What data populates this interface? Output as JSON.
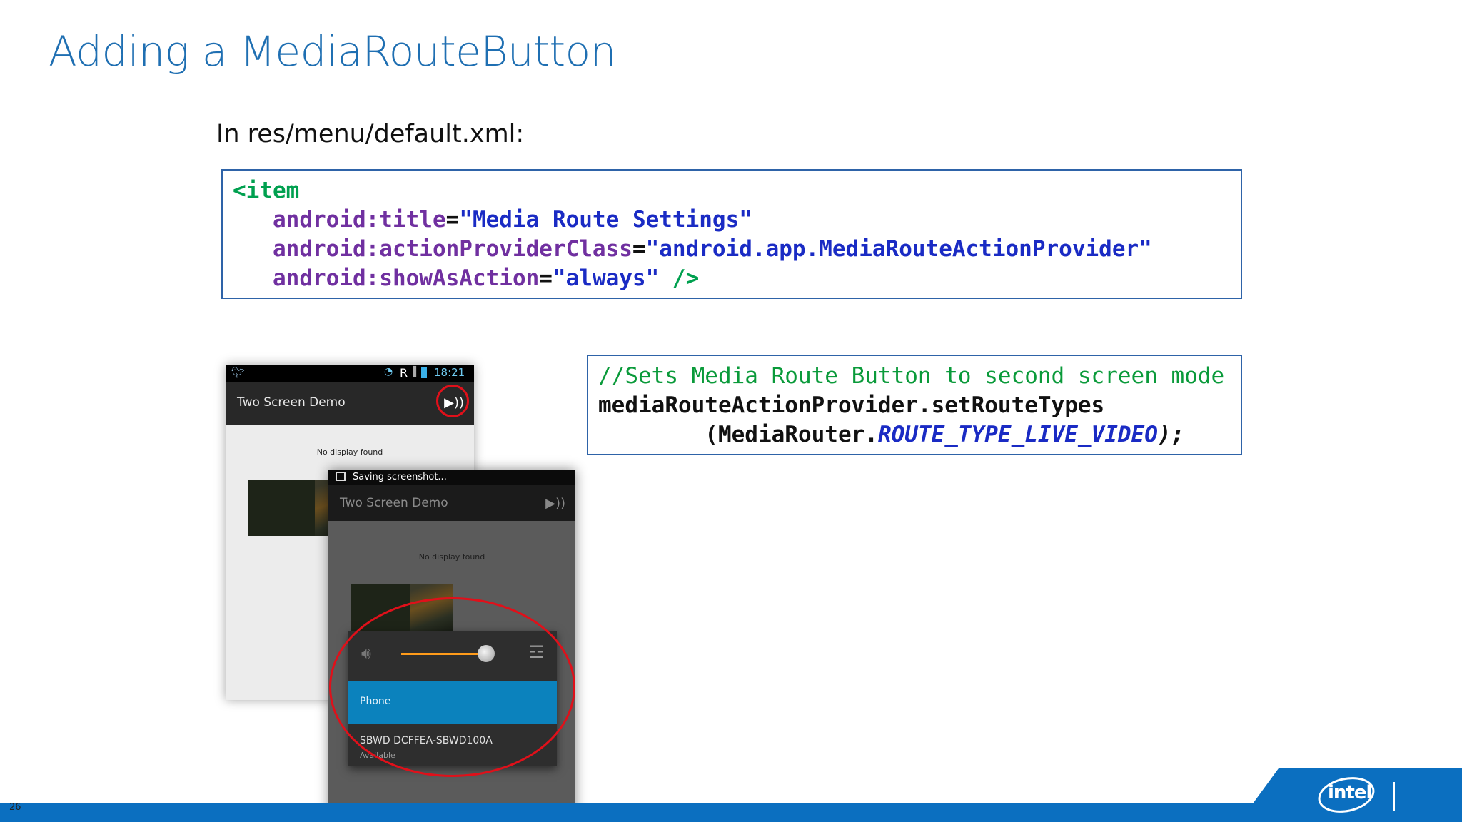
{
  "slide": {
    "title": "Adding a MediaRouteButton",
    "intro": "In res/menu/default.xml:",
    "page_number": "26"
  },
  "xml_code": {
    "tag_open": "<item",
    "attr1_name": "android:title",
    "attr1_value": "\"Media Route Settings\"",
    "attr2_name": "android:actionProviderClass",
    "attr2_value": "\"android.app.MediaRouteActionProvider\"",
    "attr3_name": "android:showAsAction",
    "attr3_value": "\"always\"",
    "tag_close": " />",
    "equals": "="
  },
  "java_code": {
    "comment": "//Sets Media Route Button to second screen mode",
    "line2": "mediaRouteActionProvider.setRouteTypes",
    "line3_prefix": "        (MediaRouter.",
    "line3_constant": "ROUTE_TYPE_LIVE_VIDEO",
    "line3_suffix": ");"
  },
  "screenshot_back": {
    "status_time": "18:21",
    "status_signal": "R",
    "app_title": "Two Screen Demo",
    "message": "No display found",
    "icons": [
      "bird-icon",
      "wifi-icon",
      "signal-icon",
      "battery-icon",
      "cast-icon"
    ]
  },
  "screenshot_front": {
    "notification": "Saving screenshot...",
    "app_title": "Two Screen Demo",
    "message": "No display found",
    "routes": [
      {
        "name": "Phone",
        "status": ""
      },
      {
        "name": "SBWD DCFFEA-SBWD100A",
        "status": "Available"
      }
    ],
    "volume_level": 0.85
  },
  "colors": {
    "title_blue": "#1f6fb2",
    "code_border": "#2e63a8",
    "footer_blue": "#0b6fc0",
    "highlight_red": "#e0101a",
    "route_selected": "#0b82bd"
  },
  "brand": {
    "logo_text": "intel"
  }
}
